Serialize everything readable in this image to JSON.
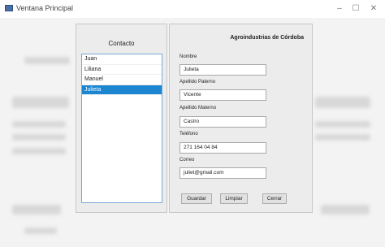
{
  "window": {
    "title": "Ventana Principal",
    "minimize": "–",
    "maximize": "☐",
    "close": "✕"
  },
  "contact_panel": {
    "title": "Contacto",
    "items": [
      "Juan",
      "Liliana",
      "Manuel",
      "Julieta"
    ],
    "selected_index": 3
  },
  "form": {
    "company": "Agroindustrias de Córdoba",
    "nombre_label": "Nombre",
    "nombre_value": "Julieta",
    "apellido_paterno_label": "Apellido Paterno",
    "apellido_paterno_value": "Vicente",
    "apellido_materno_label": "Apellido Materno",
    "apellido_materno_value": "Castro",
    "telefono_label": "Teléfono",
    "telefono_value": "271 164 04 84",
    "correo_label": "Correo",
    "correo_value": "juliet@gmail.com"
  },
  "buttons": {
    "save": "Guardar",
    "clear": "Limpiar",
    "close": "Cerrar"
  },
  "colors": {
    "selection": "#1c86d1",
    "list_border": "#7aa7d6"
  }
}
